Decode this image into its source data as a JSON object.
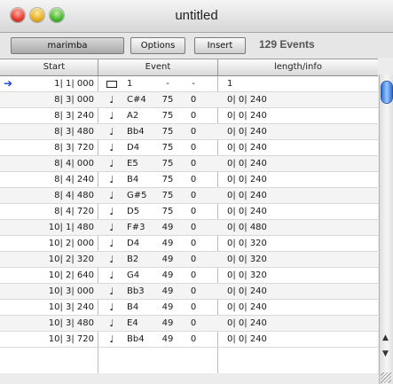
{
  "window": {
    "title": "untitled"
  },
  "toolbar": {
    "track_label": "marimba",
    "options_label": "Options",
    "insert_label": "Insert",
    "events_count": "129 Events"
  },
  "columns": {
    "start": "Start",
    "event": "Event",
    "length": "length/info"
  },
  "current_marker_icon": "right-arrow-icon",
  "rows": [
    {
      "start": "1| 1| 000",
      "symbol": "meter-box",
      "pitch": "1",
      "velocity": "-",
      "channel": "-",
      "length": "1"
    },
    {
      "start": "8| 3| 000",
      "symbol": "♩",
      "pitch": "C#4",
      "velocity": "75",
      "channel": "0",
      "length": "0| 0| 240"
    },
    {
      "start": "8| 3| 240",
      "symbol": "♩",
      "pitch": "A2",
      "velocity": "75",
      "channel": "0",
      "length": "0| 0| 240"
    },
    {
      "start": "8| 3| 480",
      "symbol": "♩",
      "pitch": "Bb4",
      "velocity": "75",
      "channel": "0",
      "length": "0| 0| 240"
    },
    {
      "start": "8| 3| 720",
      "symbol": "♩",
      "pitch": "D4",
      "velocity": "75",
      "channel": "0",
      "length": "0| 0| 240"
    },
    {
      "start": "8| 4| 000",
      "symbol": "♩",
      "pitch": "E5",
      "velocity": "75",
      "channel": "0",
      "length": "0| 0| 240"
    },
    {
      "start": "8| 4| 240",
      "symbol": "♩",
      "pitch": "B4",
      "velocity": "75",
      "channel": "0",
      "length": "0| 0| 240"
    },
    {
      "start": "8| 4| 480",
      "symbol": "♩",
      "pitch": "G#5",
      "velocity": "75",
      "channel": "0",
      "length": "0| 0| 240"
    },
    {
      "start": "8| 4| 720",
      "symbol": "♩",
      "pitch": "D5",
      "velocity": "75",
      "channel": "0",
      "length": "0| 0| 240"
    },
    {
      "start": "10| 1| 480",
      "symbol": "♩",
      "pitch": "F#3",
      "velocity": "49",
      "channel": "0",
      "length": "0| 0| 480"
    },
    {
      "start": "10| 2| 000",
      "symbol": "♩",
      "pitch": "D4",
      "velocity": "49",
      "channel": "0",
      "length": "0| 0| 320"
    },
    {
      "start": "10| 2| 320",
      "symbol": "♩",
      "pitch": "B2",
      "velocity": "49",
      "channel": "0",
      "length": "0| 0| 320"
    },
    {
      "start": "10| 2| 640",
      "symbol": "♩",
      "pitch": "G4",
      "velocity": "49",
      "channel": "0",
      "length": "0| 0| 320"
    },
    {
      "start": "10| 3| 000",
      "symbol": "♩",
      "pitch": "Bb3",
      "velocity": "49",
      "channel": "0",
      "length": "0| 0| 240"
    },
    {
      "start": "10| 3| 240",
      "symbol": "♩",
      "pitch": "B4",
      "velocity": "49",
      "channel": "0",
      "length": "0| 0| 240"
    },
    {
      "start": "10| 3| 480",
      "symbol": "♩",
      "pitch": "E4",
      "velocity": "49",
      "channel": "0",
      "length": "0| 0| 240"
    },
    {
      "start": "10| 3| 720",
      "symbol": "♩",
      "pitch": "Bb4",
      "velocity": "49",
      "channel": "0",
      "length": "0| 0| 240"
    }
  ],
  "scrollbar": {
    "up_arrow": "▲",
    "down_arrow": "▼"
  }
}
